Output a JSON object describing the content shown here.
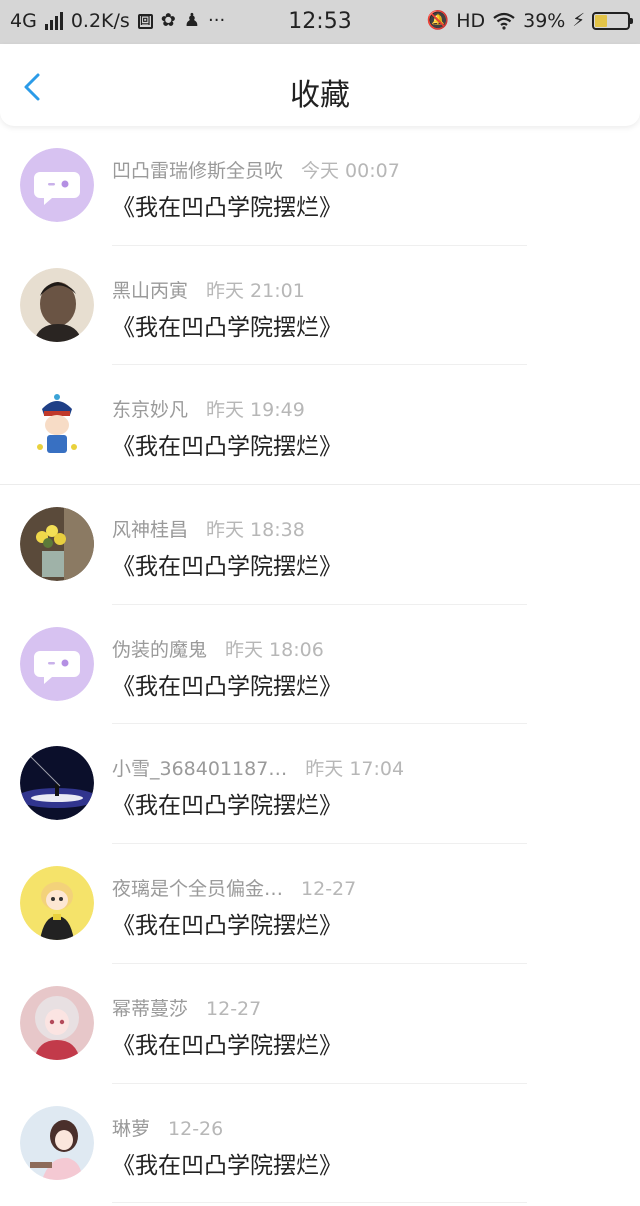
{
  "status_bar": {
    "network": "4G",
    "speed": "0.2K/s",
    "time": "12:53",
    "hd": "HD",
    "battery": "39%",
    "icons": [
      "signal-icon",
      "screen-icon",
      "wechat-icon",
      "qq-icon",
      "more-icon",
      "mute-icon",
      "wifi-icon",
      "charging-icon",
      "battery-icon"
    ]
  },
  "header": {
    "title": "收藏",
    "back_icon": "chevron-left-icon",
    "accent": "#2b9be8"
  },
  "favorites": [
    {
      "user": "凹凸雷瑞修斯全员吹",
      "time": "今天 00:07",
      "content": "《我在凹凸学院摆烂》",
      "avatar": "default-chat"
    },
    {
      "user": "黑山丙寅",
      "time": "昨天 21:01",
      "content": "《我在凹凸学院摆烂》",
      "avatar": "photo"
    },
    {
      "user": "东京妙凡",
      "time": "昨天 19:49",
      "content": "《我在凹凸学院摆烂》",
      "avatar": "cartoon"
    },
    {
      "user": "风神桂昌",
      "time": "昨天 18:38",
      "content": "《我在凹凸学院摆烂》",
      "avatar": "flowers"
    },
    {
      "user": "伪装的魔鬼",
      "time": "昨天 18:06",
      "content": "《我在凹凸学院摆烂》",
      "avatar": "default-chat"
    },
    {
      "user": "小雪_368401187…",
      "time": "昨天 17:04",
      "content": "《我在凹凸学院摆烂》",
      "avatar": "night-sky"
    },
    {
      "user": "夜璃是个全员偏金…",
      "time": "12-27",
      "content": "《我在凹凸学院摆烂》",
      "avatar": "anime-yellow"
    },
    {
      "user": "幂蒂蔓莎",
      "time": "12-27",
      "content": "《我在凹凸学院摆烂》",
      "avatar": "anime-pink"
    },
    {
      "user": "琳萝",
      "time": "12-26",
      "content": "《我在凹凸学院摆烂》",
      "avatar": "anime-light"
    }
  ]
}
